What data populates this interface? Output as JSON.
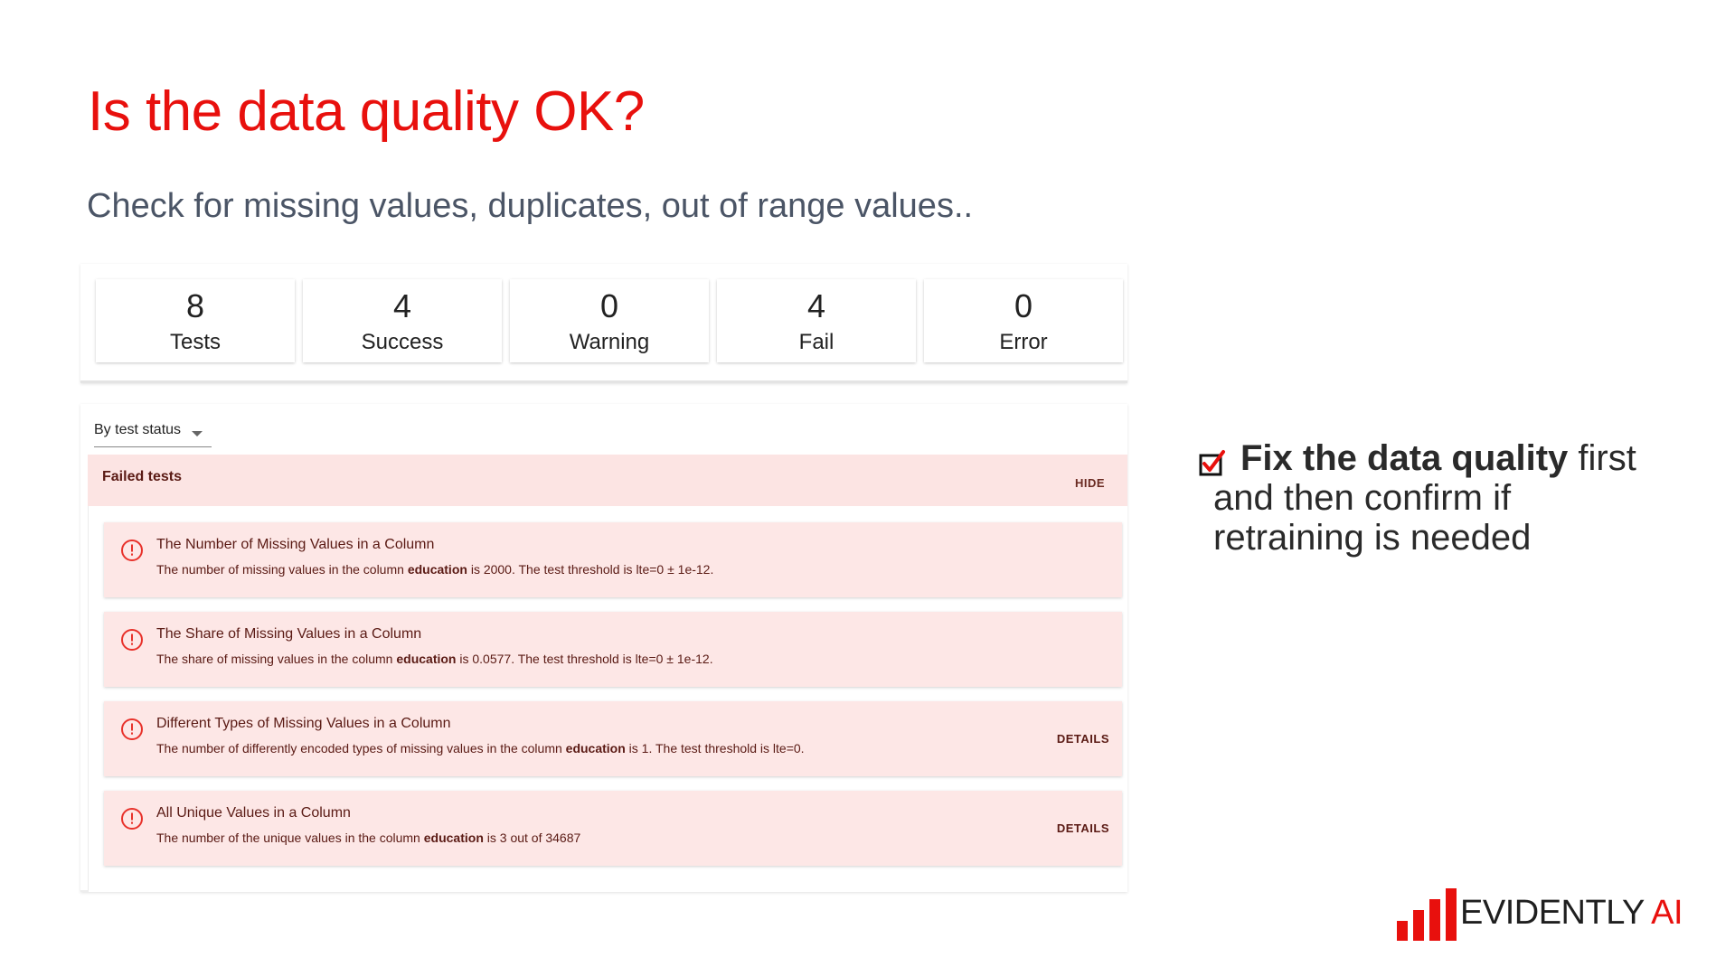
{
  "slide": {
    "title": "Is the data quality OK?",
    "subtitle": "Check for missing values, duplicates, out of range values.."
  },
  "summary": [
    {
      "value": "8",
      "label": "Tests"
    },
    {
      "value": "4",
      "label": "Success"
    },
    {
      "value": "0",
      "label": "Warning"
    },
    {
      "value": "4",
      "label": "Fail"
    },
    {
      "value": "0",
      "label": "Error"
    }
  ],
  "filter": {
    "label": "By test status"
  },
  "failed_group": {
    "title": "Failed tests",
    "hide_label": "HIDE"
  },
  "tests": [
    {
      "name": "The Number of Missing Values in a Column",
      "desc_pre": "The number of missing values in the column ",
      "column": "education",
      "desc_post": " is 2000. The test threshold is lte=0 ± 1e-12.",
      "details": ""
    },
    {
      "name": "The Share of Missing Values in a Column",
      "desc_pre": "The share of missing values in the column ",
      "column": "education",
      "desc_post": " is 0.0577. The test threshold is lte=0 ± 1e-12.",
      "details": ""
    },
    {
      "name": "Different Types of Missing Values in a Column",
      "desc_pre": "The number of differently encoded types of missing values in the column ",
      "column": "education",
      "desc_post": " is 1. The test threshold is lte=0.",
      "details": "DETAILS"
    },
    {
      "name": "All Unique Values in a Column",
      "desc_pre": "The number of the unique values in the column ",
      "column": "education",
      "desc_post": " is 3 out of 34687",
      "details": "DETAILS"
    }
  ],
  "note": {
    "bold": "Fix the data quality",
    "rest1": " first",
    "line2": "and then confirm if",
    "line3": "retraining is needed"
  },
  "logo": {
    "text": "EVIDENTLY",
    "accent": "AI"
  },
  "colors": {
    "accent": "#e8100d",
    "fail_bg": "#fde7e6",
    "fail_header_bg": "#fce4e3",
    "fail_text": "#5a1a14"
  },
  "icons": {
    "test_status": "alert-circle-icon",
    "note": "checkbox-checked-icon"
  }
}
